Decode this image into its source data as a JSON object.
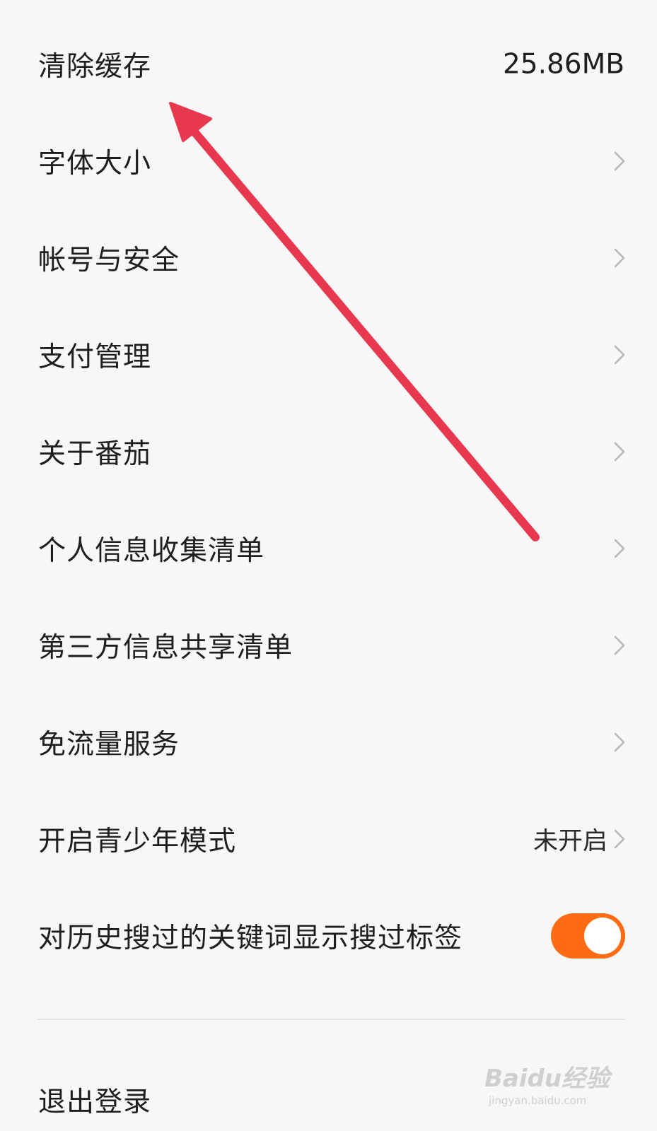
{
  "settings": {
    "clear_cache": {
      "label": "清除缓存",
      "value": "25.86MB"
    },
    "items": [
      {
        "label": "字体大小"
      },
      {
        "label": "帐号与安全"
      },
      {
        "label": "支付管理"
      },
      {
        "label": "关于番茄"
      },
      {
        "label": "个人信息收集清单"
      },
      {
        "label": "第三方信息共享清单"
      },
      {
        "label": "免流量服务"
      }
    ],
    "youth_mode": {
      "label": "开启青少年模式",
      "value": "未开启"
    },
    "search_tag": {
      "label": "对历史搜过的关键词显示搜过标签",
      "enabled": true
    },
    "logout_label": "退出登录"
  },
  "icons": {
    "chevron": "chevron-right-icon",
    "annotation": "red-arrow-annotation"
  },
  "colors": {
    "background": "#f7f7f7",
    "toggle_on": "#ff6a14",
    "chevron": "#b8b8b8",
    "annotation_arrow": "#e8384f"
  },
  "watermark": {
    "brand": "Baidu经验",
    "url": "jingyan.baidu.com"
  }
}
